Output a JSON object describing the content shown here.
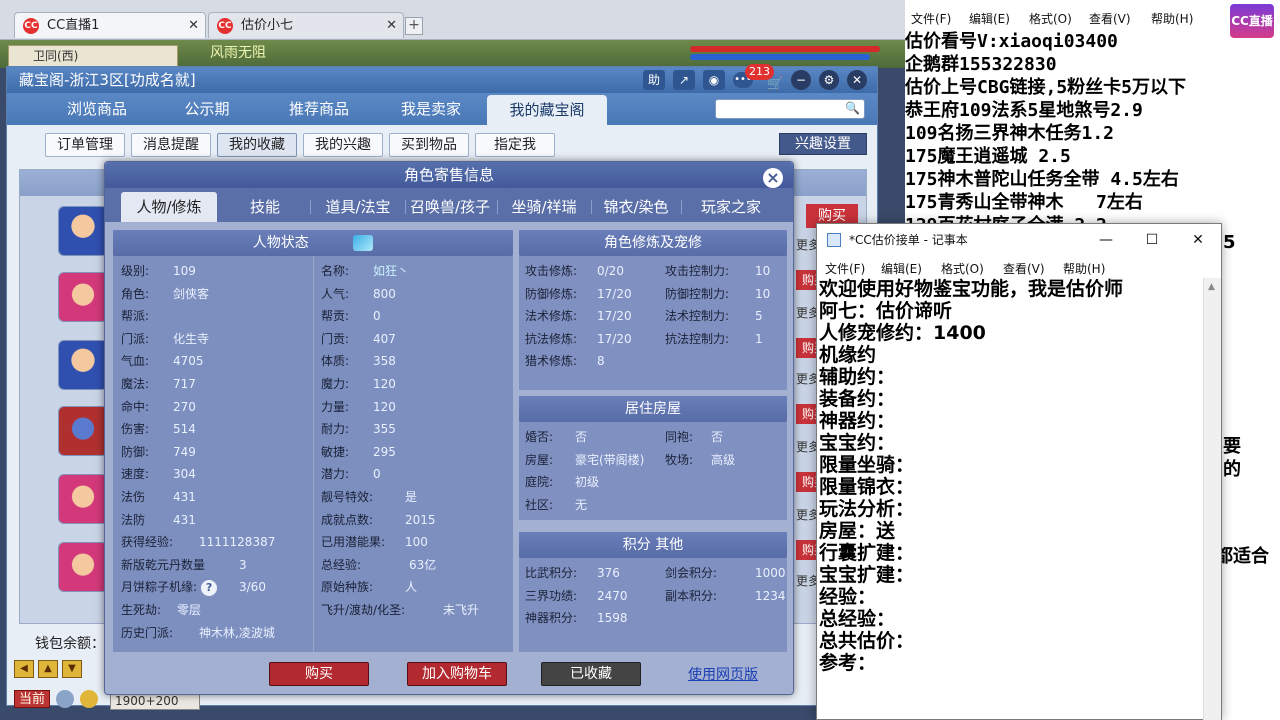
{
  "browser": {
    "tabs": [
      {
        "label": "CC直播1",
        "logo": "CC"
      },
      {
        "label": "估价小七",
        "logo": "CC"
      }
    ],
    "new_tab": "+"
  },
  "game": {
    "top_left_text": "卫同(西)",
    "map_name": "风雨无阻",
    "hud": {
      "current": "当前",
      "coords": "1900+200"
    }
  },
  "cbg": {
    "title": "藏宝阁-浙江3区[功成名就]",
    "title_icons": {
      "help": "助",
      "messages": "213"
    },
    "nav": [
      "浏览商品",
      "公示期",
      "推荐商品",
      "我是卖家",
      "我的藏宝阁"
    ],
    "subnav": [
      "订单管理",
      "消息提醒",
      "我的收藏",
      "我的兴趣",
      "买到物品",
      "指定我"
    ],
    "interest_settings": "兴趣设置",
    "list": {
      "buy": "购买",
      "more": "更多"
    },
    "wallet_label": "钱包余额："
  },
  "dialog": {
    "title": "角色寄售信息",
    "tabs": [
      "人物/修炼",
      "技能",
      "道具/法宝",
      "召唤兽/孩子",
      "坐骑/祥瑞",
      "锦衣/染色",
      "玩家之家"
    ],
    "status": {
      "header": "人物状态",
      "left": [
        {
          "k": "级别:",
          "v": "109"
        },
        {
          "k": "角色:",
          "v": "剑侠客"
        },
        {
          "k": "帮派:",
          "v": ""
        },
        {
          "k": "门派:",
          "v": "化生寺"
        },
        {
          "k": "气血:",
          "v": "4705"
        },
        {
          "k": "魔法:",
          "v": "717"
        },
        {
          "k": "命中:",
          "v": "270"
        },
        {
          "k": "伤害:",
          "v": "514"
        },
        {
          "k": "防御:",
          "v": "749"
        },
        {
          "k": "速度:",
          "v": "304"
        },
        {
          "k": "法伤",
          "v": "431"
        },
        {
          "k": "法防",
          "v": "431"
        },
        {
          "k": "获得经验:",
          "v": "1111128387"
        },
        {
          "k": "新版乾元丹数量",
          "v": "3"
        },
        {
          "k": "月饼粽子机缘:",
          "v": "3/60"
        },
        {
          "k": "生死劫:",
          "v": "零层"
        },
        {
          "k": "历史门派:",
          "v": "神木林,凌波城"
        }
      ],
      "right": [
        {
          "k": "名称:",
          "v": "如狂丶"
        },
        {
          "k": "人气:",
          "v": "800"
        },
        {
          "k": "帮贡:",
          "v": "0"
        },
        {
          "k": "门贡:",
          "v": "407"
        },
        {
          "k": "体质:",
          "v": "358"
        },
        {
          "k": "魔力:",
          "v": "120"
        },
        {
          "k": "力量:",
          "v": "120"
        },
        {
          "k": "耐力:",
          "v": "355"
        },
        {
          "k": "敏捷:",
          "v": "295"
        },
        {
          "k": "潜力:",
          "v": "0"
        },
        {
          "k": "靓号特效:",
          "v": "是"
        },
        {
          "k": "成就点数:",
          "v": "2015"
        },
        {
          "k": "已用潜能果:",
          "v": "100"
        },
        {
          "k": "总经验:",
          "v": "63亿"
        },
        {
          "k": "原始种族:",
          "v": "人"
        },
        {
          "k": "飞升/渡劫/化圣:",
          "v": "未飞升"
        }
      ]
    },
    "cultivation": {
      "header": "角色修炼及宠修",
      "rows": [
        {
          "k1": "攻击修炼:",
          "v1": "0/20",
          "k2": "攻击控制力:",
          "v2": "10"
        },
        {
          "k1": "防御修炼:",
          "v1": "17/20",
          "k2": "防御控制力:",
          "v2": "10"
        },
        {
          "k1": "法术修炼:",
          "v1": "17/20",
          "k2": "法术控制力:",
          "v2": "5"
        },
        {
          "k1": "抗法修炼:",
          "v1": "17/20",
          "k2": "抗法控制力:",
          "v2": "1"
        },
        {
          "k1": "猎术修炼:",
          "v1": "8",
          "k2": "",
          "v2": ""
        }
      ]
    },
    "house": {
      "header": "居住房屋",
      "rows": [
        {
          "k1": "婚否:",
          "v1": "否",
          "k2": "同袍:",
          "v2": "否"
        },
        {
          "k1": "房屋:",
          "v1": "豪宅(带阁楼)",
          "k2": "牧场:",
          "v2": "高级"
        },
        {
          "k1": "庭院:",
          "v1": "初级",
          "k2": "",
          "v2": ""
        },
        {
          "k1": "社区:",
          "v1": "无",
          "k2": "",
          "v2": ""
        }
      ]
    },
    "points": {
      "header": "积分 其他",
      "rows": [
        {
          "k1": "比武积分:",
          "v1": "376",
          "k2": "剑会积分:",
          "v2": "1000"
        },
        {
          "k1": "三界功绩:",
          "v1": "2470",
          "k2": "副本积分:",
          "v2": "1234"
        },
        {
          "k1": "神器积分:",
          "v1": "1598",
          "k2": "",
          "v2": ""
        }
      ]
    },
    "footer": {
      "buy": "购买",
      "add_cart": "加入购物车",
      "favorited": "已收藏",
      "web": "使用网页版"
    }
  },
  "notepad_back": {
    "menu": [
      "文件(F)",
      "编辑(E)",
      "格式(O)",
      "查看(V)",
      "帮助(H)"
    ],
    "logo": "CC直播",
    "lines": [
      "估价看号V:xiaoqi03400",
      "企鹅群155322830",
      "估价上号CBG链接,5粉丝卡5万以下",
      "恭王府109法系5星地煞号2.9",
      "109名扬三界神木任务1.2",
      "175魔王逍遥城 2.5",
      "175神木普陀山任务全带 4.5左右",
      "175青秀山全带神木   7左右",
      "129百花村庭子全满 2.2"
    ],
    "frags": [
      "5",
      "要",
      "的",
      "都适合"
    ]
  },
  "notepad_front": {
    "title": "*CC估价接单 - 记事本",
    "menu": [
      "文件(F)",
      "编辑(E)",
      "格式(O)",
      "查看(V)",
      "帮助(H)"
    ],
    "lines": [
      "欢迎使用好物鉴宝功能，我是估价师",
      "阿七：估价谛听",
      "人修宠修约：1400",
      "机缘约",
      "辅助约：",
      "装备约：",
      "神器约：",
      "宝宝约：",
      "限量坐骑：",
      "限量锦衣：",
      "玩法分析：",
      "房屋：送",
      "行囊扩建：",
      "宝宝扩建：",
      "经验：",
      "总经验：",
      "总共估价：",
      "参考："
    ]
  }
}
